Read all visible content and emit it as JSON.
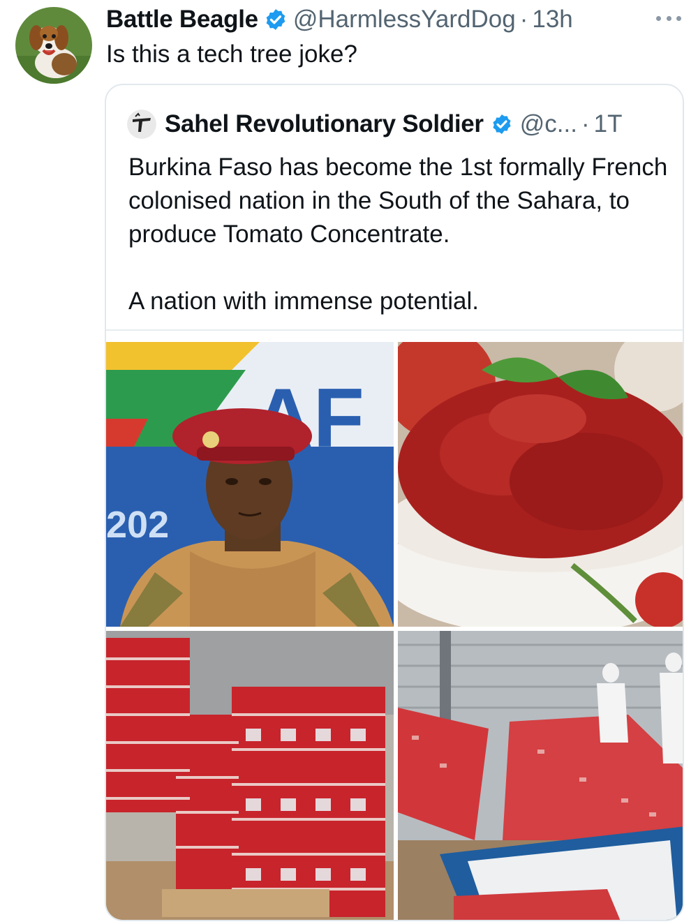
{
  "tweet": {
    "display_name": "Battle Beagle",
    "handle": "@HarmlessYardDog",
    "separator": "·",
    "time": "13h",
    "text": "Is this a tech tree joke?",
    "avatar_icon": "beagle-avatar",
    "more_icon": "more-dots-icon"
  },
  "quote": {
    "display_name": "Sahel Revolutionary Soldier",
    "handle": "@c...",
    "separator": "·",
    "time": "1T",
    "text_line1": "Burkina Faso has become the 1st formally French colonised nation in the South of the Sahara, to produce Tomato Concentrate.",
    "text_line2": "A nation with immense potential.",
    "media": [
      {
        "name": "photo-soldier-red-beret",
        "sign_text": "AF",
        "sign_year": "202"
      },
      {
        "name": "photo-tomato-paste-bowl"
      },
      {
        "name": "photo-tomato-cans-stacked"
      },
      {
        "name": "photo-tomato-sachets-factory"
      }
    ]
  },
  "colors": {
    "verified_blue": "#1d9bf0",
    "secondary_text": "#536471",
    "card_border": "#e1e8ed"
  }
}
